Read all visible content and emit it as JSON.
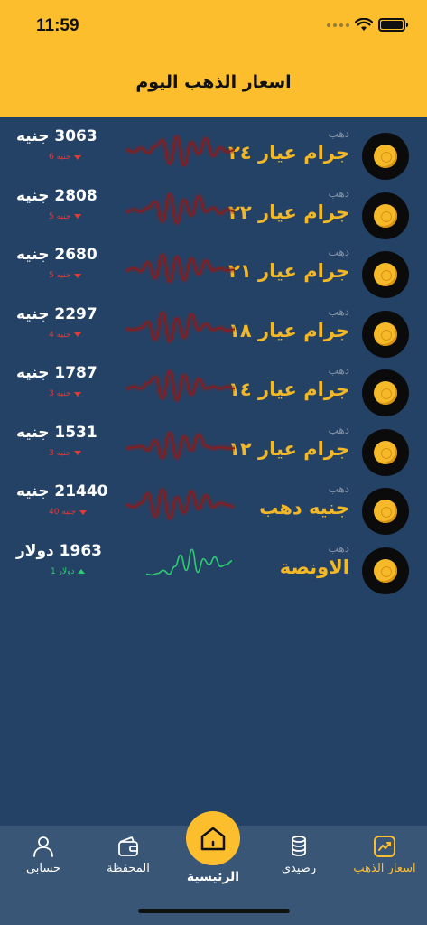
{
  "status": {
    "time": "11:59"
  },
  "header": {
    "title": "اسعار الذهب اليوم"
  },
  "colors": {
    "accent": "#fdbe2e",
    "background": "#244266",
    "down": "#e53935",
    "up": "#2ecc71",
    "sparkline_down": "#8b1a1a",
    "sparkline_up": "#2ecc71"
  },
  "items": [
    {
      "category": "دهب",
      "name": "جرام عيار ٢٤",
      "price": "3063 جنيه",
      "change": "6 جنيه",
      "direction": "down"
    },
    {
      "category": "دهب",
      "name": "جرام عيار ٢٢",
      "price": "2808 جنيه",
      "change": "5 جنيه",
      "direction": "down"
    },
    {
      "category": "دهب",
      "name": "جرام عيار ٢١",
      "price": "2680 جنيه",
      "change": "5 جنيه",
      "direction": "down"
    },
    {
      "category": "دهب",
      "name": "جرام عيار ١٨",
      "price": "2297 جنيه",
      "change": "4 جنيه",
      "direction": "down"
    },
    {
      "category": "دهب",
      "name": "جرام عيار ١٤",
      "price": "1787 جنيه",
      "change": "3 جنيه",
      "direction": "down"
    },
    {
      "category": "دهب",
      "name": "جرام عيار ١٢",
      "price": "1531 جنيه",
      "change": "3 جنيه",
      "direction": "down"
    },
    {
      "category": "دهب",
      "name": "جنيه دهب",
      "price": "21440 جنيه",
      "change": "40 جنيه",
      "direction": "down"
    },
    {
      "category": "دهب",
      "name": "الاونصة",
      "price": "1963 دولار",
      "change": "1 دولار",
      "direction": "up"
    }
  ],
  "tabs": {
    "gold_prices": "اسعار الذهب",
    "balance": "رصيدي",
    "home": "الرئيسية",
    "wallet": "المحفظة",
    "account": "حسابي"
  },
  "icons": [
    "coin-icon",
    "chart-icon",
    "coins-stack-icon",
    "home-icon",
    "wallet-icon",
    "user-icon",
    "wifi-icon",
    "battery-icon"
  ]
}
